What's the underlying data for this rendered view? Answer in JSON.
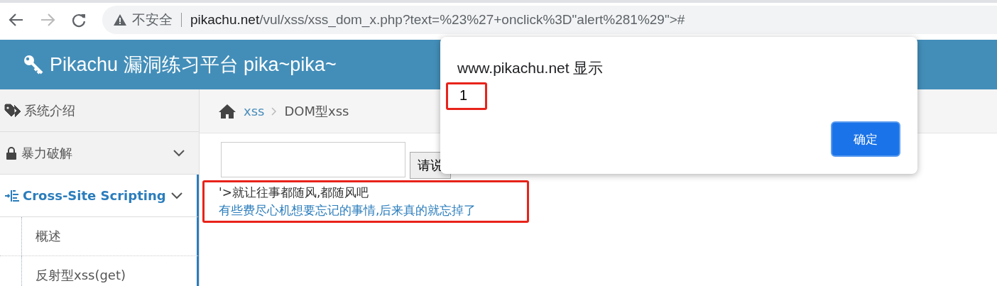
{
  "browser": {
    "security_label": "不安全",
    "url_host": "pikachu.net",
    "url_path": "/vul/xss/xss_dom_x.php?text=%23%27+onclick%3D\"alert%281%29\">#"
  },
  "header": {
    "title": "Pikachu 漏洞练习平台 pika~pika~"
  },
  "sidebar": {
    "items": [
      {
        "label": "系统介绍",
        "selected": false,
        "has_caret": false
      },
      {
        "label": "暴力破解",
        "selected": false,
        "has_caret": true
      },
      {
        "label": "Cross-Site Scripting",
        "expanded": true,
        "selected": true,
        "has_caret": true,
        "children": [
          {
            "label": "概述"
          },
          {
            "label": "反射型xss(get)"
          }
        ]
      }
    ]
  },
  "breadcrumb": {
    "link": "xss",
    "current": "DOM型xss"
  },
  "form": {
    "button": "请说"
  },
  "output": {
    "highlighted": true,
    "lines": [
      {
        "text": "'>就让往事都随风,都随风吧",
        "kind": "plain"
      },
      {
        "text": "有些费尽心机想要忘记的事情,后来真的就忘掉了",
        "kind": "link"
      }
    ]
  },
  "dialog": {
    "title": "www.pikachu.net 显示",
    "message": "1",
    "message_highlighted": true,
    "button": "确定"
  }
}
